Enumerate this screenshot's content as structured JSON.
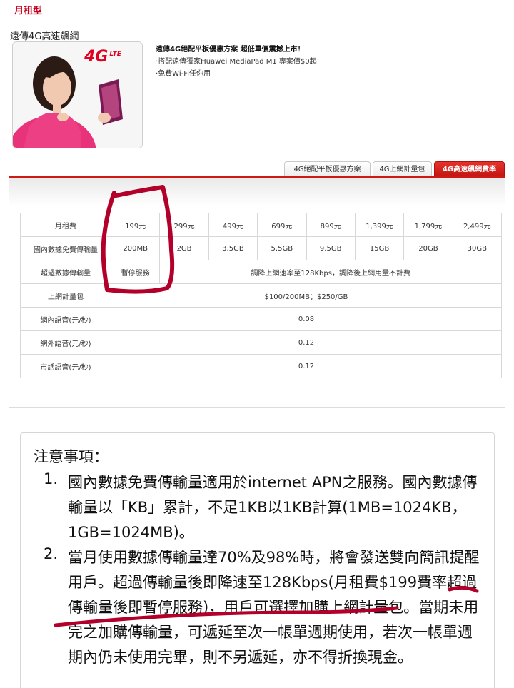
{
  "section": {
    "title": "月租型"
  },
  "promo": {
    "name": "遠傳4G高速飆網",
    "image_badge": "4G",
    "image_badge_sub": "LTE",
    "headline": "遠傳4G絕配平板優惠方案 超低單價震撼上市！",
    "line1": "·搭配遠傳獨家Huawei MediaPad M1 專案價$0起",
    "line2": "·免費Wi-Fi任你用"
  },
  "tabs": [
    {
      "label": "4G絕配平板優惠方案"
    },
    {
      "label": "4G上網計量包"
    },
    {
      "label": "4G高速飆網費率"
    }
  ],
  "rates": {
    "monthly_label": "月租費",
    "plans": [
      "199元",
      "299元",
      "499元",
      "699元",
      "899元",
      "1,399元",
      "1,799元",
      "2,499元"
    ],
    "data_label": "國內數據免費傳輸量",
    "data_amounts": [
      "200MB",
      "2GB",
      "3.5GB",
      "5.5GB",
      "9.5GB",
      "15GB",
      "20GB",
      "30GB"
    ],
    "overage_label": "超過數據傳輸量",
    "overage_first": "暫停服務",
    "overage_rest": "調降上網速率至128Kbps，調降後上網用量不計費",
    "addon_label": "上網計量包",
    "addon_value": "$100/200MB；$250/GB",
    "onnet_label": "網內語音(元/秒)",
    "onnet_value": "0.08",
    "offnet_label": "網外語音(元/秒)",
    "offnet_value": "0.12",
    "landline_label": "市話語音(元/秒)",
    "landline_value": "0.12"
  },
  "notes": {
    "heading": "注意事項：",
    "items": [
      {
        "num": "1.",
        "text": "國內數據免費傳輸量適用於internet APN之服務。國內數據傳輸量以「KB」累計，不足1KB以1KB計算(1MB=1024KB，1GB=1024MB)。"
      },
      {
        "num": "2.",
        "text": "當月使用數據傳輸量達70%及98%時，將會發送雙向簡訊提醒用戶。超過傳輸量後即降速至128Kbps(月租費$199費率超過傳輸量後即暫停服務)，用戶可選擇加購上網計量包。當期未用完之加購傳輸量，可遞延至次一帳單週期使用，若次一帳單週期內仍未使用完畢，則不另遞延，亦不得折換現金。"
      }
    ]
  },
  "colors": {
    "brand_red": "#c8001e",
    "annotation_red": "#b3002a"
  }
}
